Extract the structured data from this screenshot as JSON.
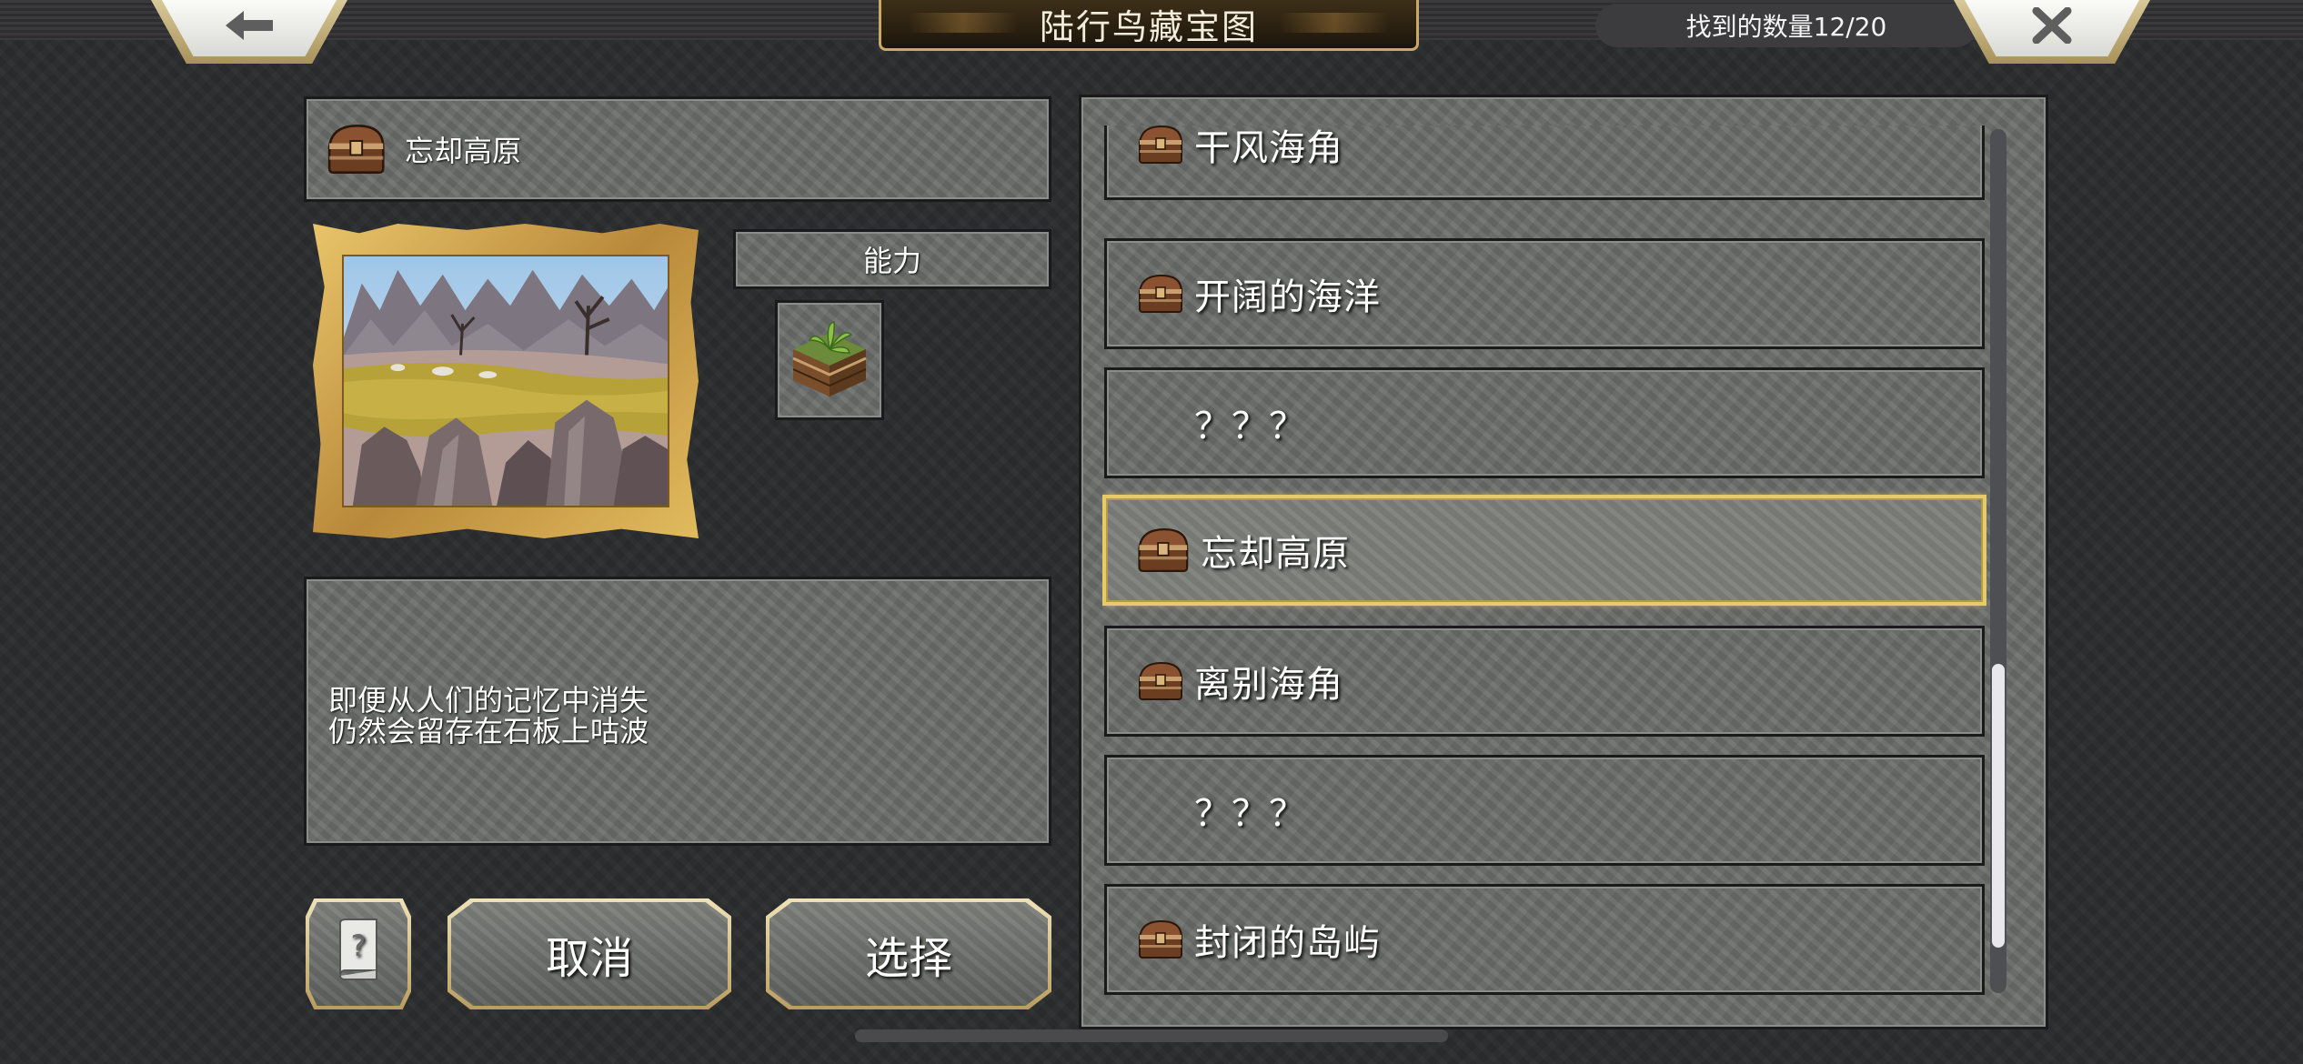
{
  "header": {
    "title": "陆行鸟藏宝图",
    "found_count": "找到的数量12/20",
    "back_icon": "arrow-left-icon",
    "close_icon": "close-x-icon"
  },
  "detail": {
    "name": "忘却高原",
    "ability_label": "能力",
    "ability_icon": "grass-block-icon",
    "description_lines": [
      "即便从人们的记忆中消失",
      "仍然会留存在石板上咕波"
    ]
  },
  "buttons": {
    "help_icon": "help-book-icon",
    "cancel": "取消",
    "select": "选择"
  },
  "list": {
    "items": [
      {
        "label": "干风海角",
        "found": true,
        "selected": false
      },
      {
        "label": "开阔的海洋",
        "found": true,
        "selected": false
      },
      {
        "label": "？？？",
        "found": false,
        "selected": false
      },
      {
        "label": "忘却高原",
        "found": true,
        "selected": true
      },
      {
        "label": "离别海角",
        "found": true,
        "selected": false
      },
      {
        "label": "？？？",
        "found": false,
        "selected": false
      },
      {
        "label": "封闭的岛屿",
        "found": true,
        "selected": false
      }
    ]
  },
  "colors": {
    "selected_border": "#e6cb6a",
    "frame_gold": "#c9a968",
    "panel_stone": "#6a6d69"
  }
}
